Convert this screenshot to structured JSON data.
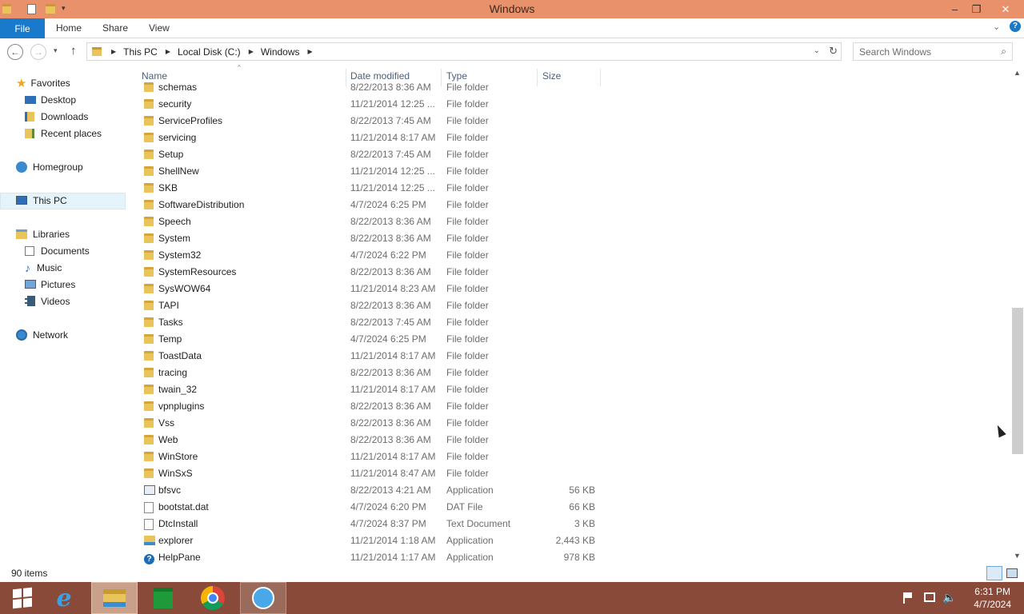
{
  "window": {
    "title": "Windows"
  },
  "ribbon": {
    "file": "File",
    "tabs": [
      "Home",
      "Share",
      "View"
    ]
  },
  "address": {
    "crumbs": [
      "This PC",
      "Local Disk (C:)",
      "Windows"
    ],
    "search_placeholder": "Search Windows"
  },
  "nav": {
    "favorites": "Favorites",
    "desktop": "Desktop",
    "downloads": "Downloads",
    "recent": "Recent places",
    "homegroup": "Homegroup",
    "thispc": "This PC",
    "libraries": "Libraries",
    "documents": "Documents",
    "music": "Music",
    "pictures": "Pictures",
    "videos": "Videos",
    "network": "Network"
  },
  "columns": {
    "name": "Name",
    "date": "Date modified",
    "type": "Type",
    "size": "Size"
  },
  "files": [
    {
      "name": "schemas",
      "date": "8/22/2013 8:36 AM",
      "type": "File folder",
      "size": "",
      "icon": "folder-icon"
    },
    {
      "name": "security",
      "date": "11/21/2014 12:25 ...",
      "type": "File folder",
      "size": "",
      "icon": "folder-icon"
    },
    {
      "name": "ServiceProfiles",
      "date": "8/22/2013 7:45 AM",
      "type": "File folder",
      "size": "",
      "icon": "folder-icon"
    },
    {
      "name": "servicing",
      "date": "11/21/2014 8:17 AM",
      "type": "File folder",
      "size": "",
      "icon": "folder-icon"
    },
    {
      "name": "Setup",
      "date": "8/22/2013 7:45 AM",
      "type": "File folder",
      "size": "",
      "icon": "folder-icon"
    },
    {
      "name": "ShellNew",
      "date": "11/21/2014 12:25 ...",
      "type": "File folder",
      "size": "",
      "icon": "folder-icon"
    },
    {
      "name": "SKB",
      "date": "11/21/2014 12:25 ...",
      "type": "File folder",
      "size": "",
      "icon": "folder-icon"
    },
    {
      "name": "SoftwareDistribution",
      "date": "4/7/2024 6:25 PM",
      "type": "File folder",
      "size": "",
      "icon": "folder-icon"
    },
    {
      "name": "Speech",
      "date": "8/22/2013 8:36 AM",
      "type": "File folder",
      "size": "",
      "icon": "folder-icon"
    },
    {
      "name": "System",
      "date": "8/22/2013 8:36 AM",
      "type": "File folder",
      "size": "",
      "icon": "folder-icon"
    },
    {
      "name": "System32",
      "date": "4/7/2024 6:22 PM",
      "type": "File folder",
      "size": "",
      "icon": "folder-icon"
    },
    {
      "name": "SystemResources",
      "date": "8/22/2013 8:36 AM",
      "type": "File folder",
      "size": "",
      "icon": "folder-icon"
    },
    {
      "name": "SysWOW64",
      "date": "11/21/2014 8:23 AM",
      "type": "File folder",
      "size": "",
      "icon": "folder-icon"
    },
    {
      "name": "TAPI",
      "date": "8/22/2013 8:36 AM",
      "type": "File folder",
      "size": "",
      "icon": "folder-icon"
    },
    {
      "name": "Tasks",
      "date": "8/22/2013 7:45 AM",
      "type": "File folder",
      "size": "",
      "icon": "folder-icon"
    },
    {
      "name": "Temp",
      "date": "4/7/2024 6:25 PM",
      "type": "File folder",
      "size": "",
      "icon": "folder-icon"
    },
    {
      "name": "ToastData",
      "date": "11/21/2014 8:17 AM",
      "type": "File folder",
      "size": "",
      "icon": "folder-icon"
    },
    {
      "name": "tracing",
      "date": "8/22/2013 8:36 AM",
      "type": "File folder",
      "size": "",
      "icon": "folder-icon"
    },
    {
      "name": "twain_32",
      "date": "11/21/2014 8:17 AM",
      "type": "File folder",
      "size": "",
      "icon": "folder-icon"
    },
    {
      "name": "vpnplugins",
      "date": "8/22/2013 8:36 AM",
      "type": "File folder",
      "size": "",
      "icon": "folder-icon"
    },
    {
      "name": "Vss",
      "date": "8/22/2013 8:36 AM",
      "type": "File folder",
      "size": "",
      "icon": "folder-icon"
    },
    {
      "name": "Web",
      "date": "8/22/2013 8:36 AM",
      "type": "File folder",
      "size": "",
      "icon": "folder-icon"
    },
    {
      "name": "WinStore",
      "date": "11/21/2014 8:17 AM",
      "type": "File folder",
      "size": "",
      "icon": "folder-icon"
    },
    {
      "name": "WinSxS",
      "date": "11/21/2014 8:47 AM",
      "type": "File folder",
      "size": "",
      "icon": "folder-icon"
    },
    {
      "name": "bfsvc",
      "date": "8/22/2013 4:21 AM",
      "type": "Application",
      "size": "56 KB",
      "icon": "app-icon"
    },
    {
      "name": "bootstat.dat",
      "date": "4/7/2024 6:20 PM",
      "type": "DAT File",
      "size": "66 KB",
      "icon": "file-icon"
    },
    {
      "name": "DtcInstall",
      "date": "4/7/2024 8:37 PM",
      "type": "Text Document",
      "size": "3 KB",
      "icon": "file-icon"
    },
    {
      "name": "explorer",
      "date": "11/21/2014 1:18 AM",
      "type": "Application",
      "size": "2,443 KB",
      "icon": "explorer-icon"
    },
    {
      "name": "HelpPane",
      "date": "11/21/2014 1:17 AM",
      "type": "Application",
      "size": "978 KB",
      "icon": "help-icon"
    }
  ],
  "status": {
    "count": "90 items"
  },
  "clock": {
    "time": "6:31 PM",
    "date": "4/7/2024"
  },
  "colors": {
    "titlebar": "#e8916a",
    "taskbar": "#8a4a3a",
    "accent": "#1979ca"
  }
}
